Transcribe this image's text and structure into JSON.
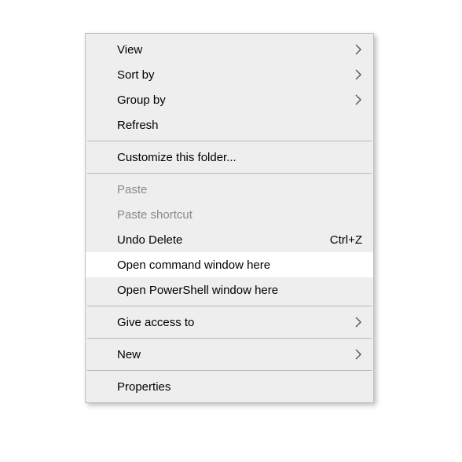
{
  "menu": {
    "items": [
      {
        "label": "View",
        "submenu": true
      },
      {
        "label": "Sort by",
        "submenu": true
      },
      {
        "label": "Group by",
        "submenu": true
      },
      {
        "label": "Refresh"
      }
    ],
    "customize": [
      {
        "label": "Customize this folder..."
      }
    ],
    "clipboard": [
      {
        "label": "Paste",
        "disabled": true
      },
      {
        "label": "Paste shortcut",
        "disabled": true
      },
      {
        "label": "Undo Delete",
        "shortcut": "Ctrl+Z"
      },
      {
        "label": "Open command window here",
        "highlight": true
      },
      {
        "label": "Open PowerShell window here"
      }
    ],
    "access": [
      {
        "label": "Give access to",
        "submenu": true
      }
    ],
    "new": [
      {
        "label": "New",
        "submenu": true
      }
    ],
    "props": [
      {
        "label": "Properties"
      }
    ]
  }
}
